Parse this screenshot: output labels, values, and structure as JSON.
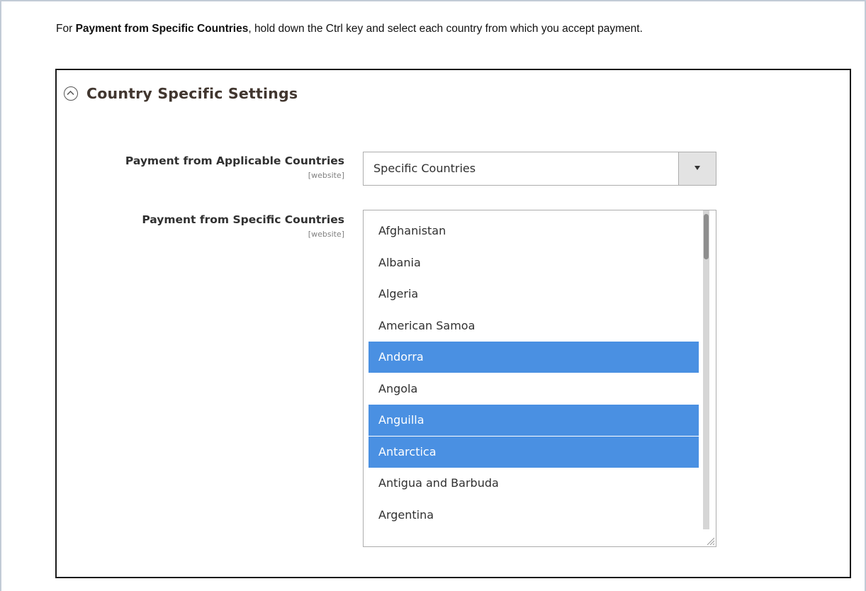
{
  "instruction": {
    "prefix": "For ",
    "bold": "Payment from Specific Countries",
    "suffix": ", hold down the Ctrl key and select each country from which you accept payment."
  },
  "section": {
    "title": "Country Specific Settings",
    "icon": "collapse-circle-icon"
  },
  "applicable_countries": {
    "label": "Payment from Applicable Countries",
    "scope": "[website]",
    "value": "Specific Countries"
  },
  "specific_countries": {
    "label": "Payment from Specific Countries",
    "scope": "[website]",
    "options": [
      {
        "label": "Afghanistan",
        "selected": false
      },
      {
        "label": "Albania",
        "selected": false
      },
      {
        "label": "Algeria",
        "selected": false
      },
      {
        "label": "American Samoa",
        "selected": false
      },
      {
        "label": "Andorra",
        "selected": true
      },
      {
        "label": "Angola",
        "selected": false
      },
      {
        "label": "Anguilla",
        "selected": true
      },
      {
        "label": "Antarctica",
        "selected": true
      },
      {
        "label": "Antigua and Barbuda",
        "selected": false
      },
      {
        "label": "Argentina",
        "selected": false
      }
    ]
  },
  "colors": {
    "selected_bg": "#4a90e2",
    "frame_border": "#c2cbd6"
  }
}
